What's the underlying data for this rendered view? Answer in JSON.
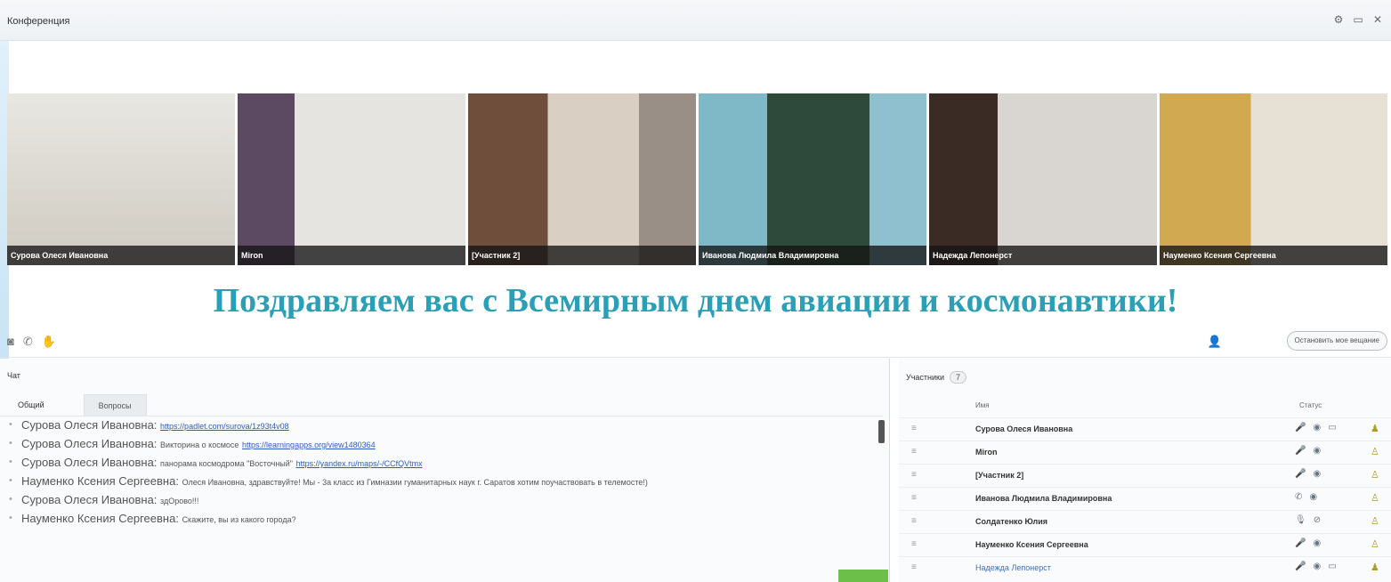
{
  "window": {
    "title": "Конференция",
    "controls": {
      "settings_icon": "gear-icon",
      "maximize_icon": "window-icon",
      "close_icon": "close-icon"
    }
  },
  "video_tiles": [
    {
      "name": "Сурова Олеся Ивановна"
    },
    {
      "name": "Мiron"
    },
    {
      "name": "[Участник 2]"
    },
    {
      "name": "Иванова Людмила Владимировна"
    },
    {
      "name": "Надежда Лепонерст"
    },
    {
      "name": "Науменко Ксения Сергеевна"
    }
  ],
  "banner": "Поздравляем вас с Всемирным днем авиации и космонавтики!",
  "toolbar": {
    "icons": [
      "video-camera-icon",
      "phone-icon",
      "hand-icon"
    ],
    "stop_button": "Остановить мое вещание"
  },
  "chat": {
    "title": "Чат",
    "tabs": {
      "general": "Общий",
      "questions": "Вопросы"
    },
    "messages": [
      {
        "author": "Сурова Олеся Ивановна:",
        "text": "",
        "link": "https://padlet.com/surova/1z93t4v08"
      },
      {
        "author": "Сурова Олеся Ивановна:",
        "text": "Викторина о космосе",
        "link": "https://learningapps.org/view1480364"
      },
      {
        "author": "Сурова Олеся Ивановна:",
        "text": "панорама космодрома \"Восточный\"",
        "link": "https://yandex.ru/maps/-/CCfQVtmx"
      },
      {
        "author": "Науменко Ксения Сергеевна:",
        "text": "Олеся Ивановна, здравствуйте! Мы - 3а класс из Гимназии гуманитарных наук г. Саратов хотим поучаствовать в телемосте!)",
        "link": ""
      },
      {
        "author": "Сурова Олеся Ивановна:",
        "text": "здOрово!!!",
        "link": ""
      },
      {
        "author": "Науменко Ксения Сергеевна:",
        "text": "Скажите, вы из какого города?",
        "link": ""
      }
    ]
  },
  "participants": {
    "title": "Участники",
    "count": "7",
    "column_name": "Имя",
    "column_status": "Статус",
    "list": [
      {
        "name": "Сурова Олеся Ивановна"
      },
      {
        "name": "Мiron"
      },
      {
        "name": "[Участник 2]"
      },
      {
        "name": "Иванова Людмила Владимировна"
      },
      {
        "name": "Солдатенко Юлия"
      },
      {
        "name": "Науменко Ксения Сергеевна"
      },
      {
        "name": "Надежда Лепонерст"
      }
    ]
  }
}
